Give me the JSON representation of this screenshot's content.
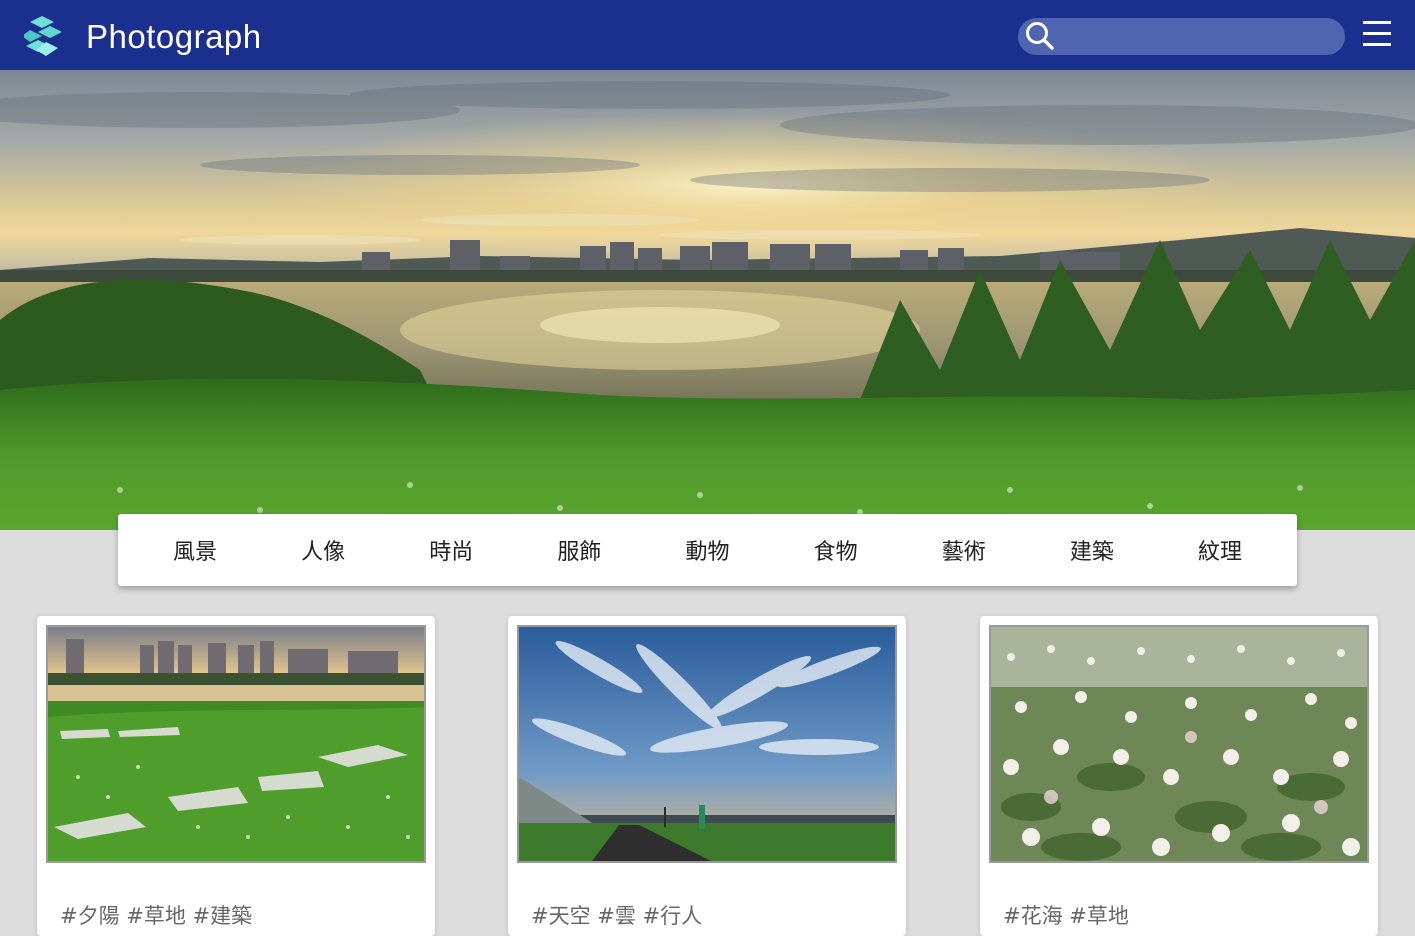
{
  "header": {
    "brand": "Photograph",
    "search_placeholder": ""
  },
  "categories": [
    "風景",
    "人像",
    "時尚",
    "服飾",
    "動物",
    "食物",
    "藝術",
    "建築",
    "紋理"
  ],
  "cards": [
    {
      "tags": "#夕陽 #草地 #建築"
    },
    {
      "tags": "#天空 #雲 #行人"
    },
    {
      "tags": "#花海 #草地"
    }
  ],
  "colors": {
    "header_bg": "#1b308e",
    "search_bg": "#5065b2",
    "logo": "#5fd6d0",
    "page_bg": "#dcdcdc"
  },
  "icons": [
    "logo-icon",
    "search-icon",
    "hamburger-menu-icon"
  ]
}
